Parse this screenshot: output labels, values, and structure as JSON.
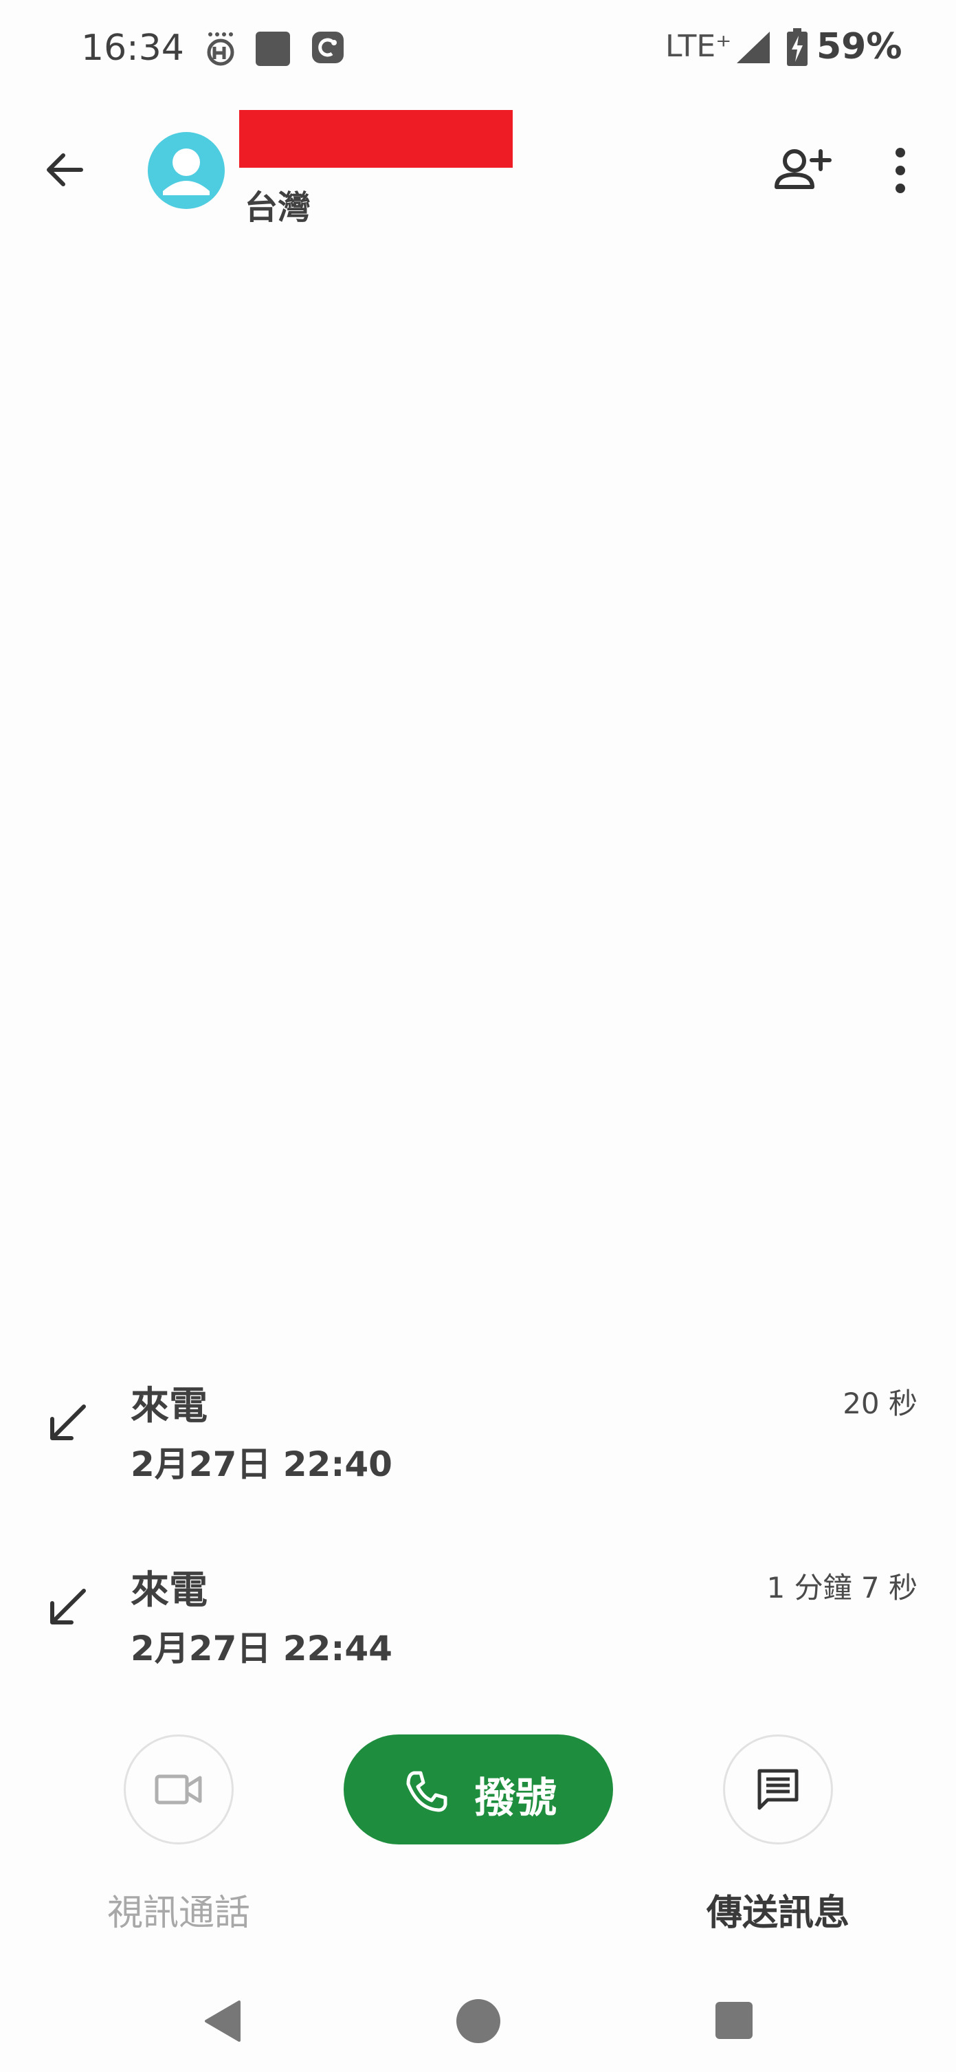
{
  "status_bar": {
    "time": "16:34",
    "network": "LTE⁺",
    "battery": "59%",
    "icons": [
      "notification-app-icon",
      "notification-square-icon",
      "notification-c-icon",
      "signal-icon",
      "battery-charging-icon"
    ]
  },
  "header": {
    "location": "台灣",
    "icons": [
      "back-arrow-icon",
      "avatar-person-icon",
      "add-contact-icon",
      "more-vert-icon"
    ],
    "accent_color": "#4fcde0",
    "redaction_color": "#ee1c25"
  },
  "call_log": [
    {
      "type": "來電",
      "datetime": "2月27日 22:40",
      "duration": "20 秒",
      "icon": "incoming-call-arrow-icon"
    },
    {
      "type": "來電",
      "datetime": "2月27日 22:44",
      "duration": "1 分鐘 7 秒",
      "icon": "incoming-call-arrow-icon"
    }
  ],
  "actions": {
    "video_call": {
      "label": "視訊通話",
      "icon": "videocam-icon",
      "enabled": false
    },
    "dial": {
      "label": "撥號",
      "icon": "phone-icon",
      "color": "#1e8e3e"
    },
    "message": {
      "label": "傳送訊息",
      "icon": "message-icon"
    }
  },
  "nav_bar": {
    "icons": [
      "nav-back-icon",
      "nav-home-icon",
      "nav-recents-icon"
    ]
  }
}
